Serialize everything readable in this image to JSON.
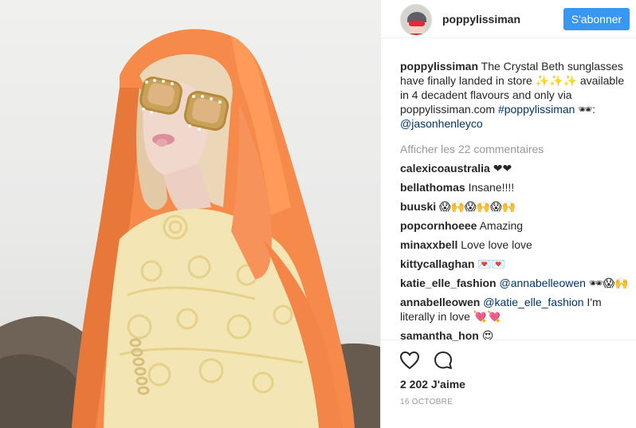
{
  "post": {
    "username": "poppylissiman",
    "follow_label": "S'abonner",
    "caption": {
      "username": "poppylissiman",
      "text": " The Crystal Beth sunglasses have finally landed in store ✨✨✨ available in 4 decadent flavours and only via poppylissiman.com ",
      "hashtag": "#poppylissiman",
      "after_hashtag": " 🕶: ",
      "mention": "@jasonhenleyco"
    },
    "load_more_label": "Afficher les 22 commentaires",
    "comments": [
      {
        "user": "calexicoaustralia",
        "text": " ❤❤"
      },
      {
        "user": "bellathomas",
        "text": " Insane!!!!"
      },
      {
        "user": "buuski",
        "text": " 😱🙌😱🙌😱🙌"
      },
      {
        "user": "popcornhoeee",
        "text": " Amazing"
      },
      {
        "user": "minaxxbell",
        "text": " Love love love"
      },
      {
        "user": "kittycallaghan",
        "text": " 💌💌"
      },
      {
        "user": "katie_elle_fashion",
        "mention": " @annabelleowen",
        "text": " 🕶😱🙌"
      },
      {
        "user": "annabelleowen",
        "mention": " @katie_elle_fashion",
        "text": " I'm literally in love 💘💘"
      },
      {
        "user": "samantha_hon",
        "text": " 😍"
      }
    ],
    "likes": "2 202 J'aime",
    "date": "16 OCTOBRE"
  },
  "colors": {
    "follow": "#3897f0",
    "link": "#003569",
    "muted": "#999999"
  },
  "icons": [
    "heart-icon",
    "comment-icon"
  ]
}
